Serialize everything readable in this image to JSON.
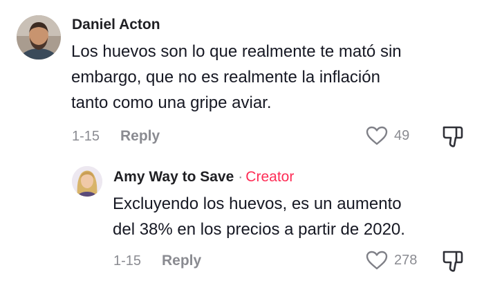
{
  "comments": [
    {
      "username": "Daniel Acton",
      "text": "Los huevos son lo que realmente te mató sin\nembargo, que no es realmente la inflación\ntanto como una gripe aviar.",
      "date": "1-15",
      "reply_label": "Reply",
      "likes": "49",
      "avatar_icon": "avatar-man-bearded",
      "like_icon": "heart-outline-icon",
      "dislike_icon": "thumbs-down-icon"
    },
    {
      "username": "Amy Way to Save",
      "creator_separator": "·",
      "creator_label": "Creator",
      "text": "Excluyendo los huevos, es un aumento\ndel 38% en los precios a partir de 2020.",
      "date": "1-15",
      "reply_label": "Reply",
      "likes": "278",
      "avatar_icon": "avatar-woman-blonde",
      "like_icon": "heart-outline-icon",
      "dislike_icon": "thumbs-down-icon"
    }
  ],
  "colors": {
    "creator_accent": "#fe2c55",
    "secondary_text": "#8a8b91",
    "primary_text": "#161823"
  }
}
